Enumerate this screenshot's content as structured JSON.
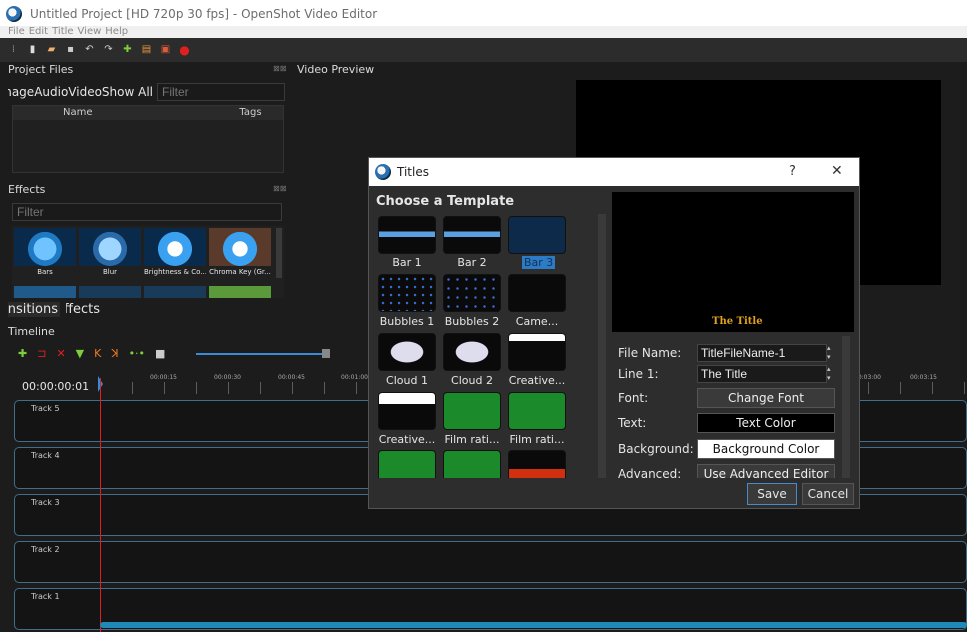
{
  "window": {
    "title": "Untitled Project [HD 720p 30 fps] - OpenShot Video Editor"
  },
  "menu": {
    "items": [
      "File",
      "Edit",
      "Title",
      "View",
      "Help"
    ]
  },
  "project_files": {
    "title": "Project Files",
    "tabs": [
      "Show All",
      "Video",
      "Audio",
      "Image"
    ],
    "filter_placeholder": "Filter",
    "columns": [
      "Name",
      "Tags"
    ]
  },
  "video_preview": {
    "title": "Video Preview"
  },
  "effects": {
    "title": "Effects",
    "filter_placeholder": "Filter",
    "items": [
      "Bars",
      "Blur",
      "Brightness & Co...",
      "Chroma Key (Gr..."
    ]
  },
  "bottom_tabs": [
    "Transitions",
    "Effects"
  ],
  "timeline": {
    "title": "Timeline",
    "timecode": "00:00:00:01",
    "ticks": [
      "00:00:15",
      "00:00:30",
      "00:00:45",
      "00:01:00",
      "00:03:00",
      "00:03:15"
    ],
    "tracks": [
      "Track 5",
      "Track 4",
      "Track 3",
      "Track 2",
      "Track 1"
    ]
  },
  "dialog": {
    "title": "Titles",
    "help": "?",
    "close": "✕",
    "choose": "Choose a Template",
    "templates": [
      "Bar 1",
      "Bar 2",
      "Bar 3",
      "Bubbles 1",
      "Bubbles 2",
      "Came...",
      "Cloud 1",
      "Cloud 2",
      "Creative...",
      "Creative...",
      "Film rati...",
      "Film rati..."
    ],
    "selected": "Bar 3",
    "preview_text": "The Title",
    "fields": {
      "file_name_label": "File Name:",
      "file_name_value": "TitleFileName-1",
      "line1_label": "Line 1:",
      "line1_value": "The Title",
      "font_label": "Font:",
      "font_button": "Change Font",
      "text_label": "Text:",
      "text_button": "Text Color",
      "bg_label": "Background:",
      "bg_button": "Background Color",
      "adv_label": "Advanced:",
      "adv_button": "Use Advanced Editor"
    },
    "save": "Save",
    "cancel": "Cancel"
  }
}
